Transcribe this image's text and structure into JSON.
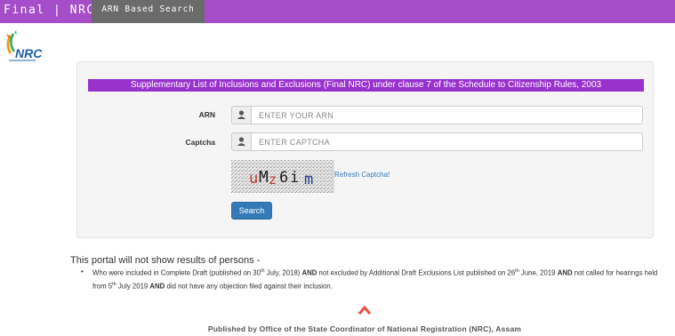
{
  "header": {
    "brand": "Final | NRC",
    "nav_tab": "ARN Based Search",
    "accent_color": "#a64dc9",
    "tab_color": "#6b6b6b"
  },
  "logo": {
    "text": "NRC",
    "icon": "nrc-logo-icon"
  },
  "form": {
    "banner": "Supplementary List of Inclusions and Exclusions (Final NRC) under clause 7 of the Schedule to Citizenship Rules, 2003",
    "banner_color": "#9932cc",
    "arn_label": "ARN",
    "arn_placeholder": "ENTER YOUR ARN",
    "arn_value": "",
    "captcha_label": "Captcha",
    "captcha_placeholder": "ENTER CAPTCHA",
    "captcha_value": "",
    "captcha_text": "uMz6i m",
    "refresh_label": "Refresh Captcha!",
    "search_label": "Search",
    "user_icon": "user-icon"
  },
  "notice": {
    "title": "This portal will not show results of persons -",
    "items": [
      {
        "p1": "Who were included in Complete Draft (published on 30",
        "sup1": "th",
        "p2": " July, 2018) ",
        "b1": "AND",
        "p3": " not excluded by Additional Draft Exclusions List published on 26",
        "sup2": "th",
        "p4": " June, 2019 ",
        "b2": "AND",
        "p5": " not called for hearings held from 5",
        "sup3": "th",
        "p6": " July 2019 ",
        "b3": "AND",
        "p7": " did not have any objection filed against their inclusion."
      }
    ]
  },
  "scroll_top_icon": "chevron-up-icon",
  "footer": "Published by Office of the State Coordinator of National Registration (NRC), Assam"
}
